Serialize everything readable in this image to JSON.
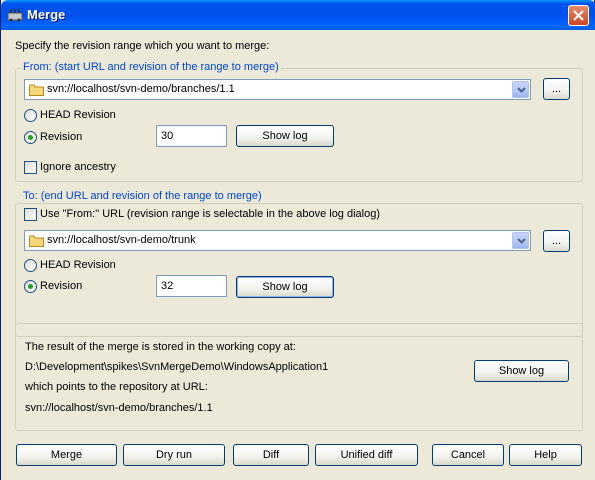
{
  "window": {
    "title": "Merge"
  },
  "intro": "Specify the revision range which you want to merge:",
  "from": {
    "legend": "From: (start URL and revision of the range to merge)",
    "url": "svn://localhost/svn-demo/branches/1.1",
    "browse_label": "...",
    "head_label": "HEAD Revision",
    "revision_label": "Revision",
    "revision_value": "30",
    "selected": "revision",
    "show_log_label": "Show log",
    "ignore_ancestry_label": "Ignore ancestry",
    "ignore_ancestry_checked": false
  },
  "to": {
    "legend": "To: (end URL and revision of the range to merge)",
    "use_from_label": "Use \"From:\" URL (revision range is selectable in the above log dialog)",
    "use_from_checked": false,
    "url": "svn://localhost/svn-demo/trunk",
    "browse_label": "...",
    "head_label": "HEAD Revision",
    "revision_label": "Revision",
    "revision_value": "32",
    "selected": "revision",
    "show_log_label": "Show log"
  },
  "result": {
    "stored_label": "The result of the merge is stored in the working copy at:",
    "working_copy": "D:\\Development\\spikes\\SvnMergeDemo\\WindowsApplication1",
    "points_label": "which points to the repository at URL:",
    "repo_url": "svn://localhost/svn-demo/branches/1.1",
    "show_log_label": "Show log"
  },
  "buttons": {
    "merge": "Merge",
    "dry_run": "Dry run",
    "diff": "Diff",
    "unified_diff": "Unified diff",
    "cancel": "Cancel",
    "help": "Help"
  },
  "icons": {
    "title": "merge-app-icon",
    "close": "close-icon",
    "folder": "folder-icon",
    "dropdown": "chevron-down-icon"
  },
  "colors": {
    "titlebar": "#0053ee",
    "legend_text": "#0046d5",
    "dialog_bg": "#ece9d8"
  }
}
